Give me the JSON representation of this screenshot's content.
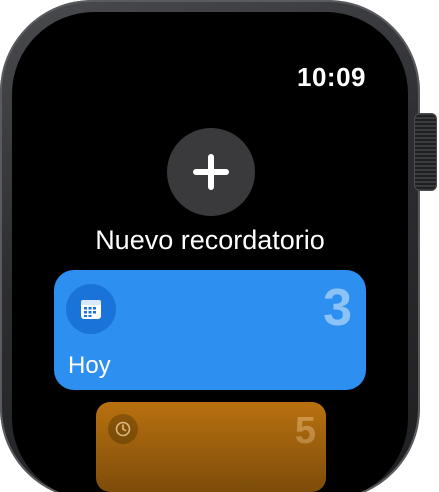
{
  "status": {
    "time": "10:09"
  },
  "actions": {
    "new_reminder_label": "Nuevo recordatorio",
    "new_reminder_icon": "plus-icon"
  },
  "lists": [
    {
      "label": "Hoy",
      "count": "3",
      "icon": "calendar-icon",
      "color": "#2d8ff0"
    },
    {
      "label": "",
      "count": "5",
      "icon": "clock-icon",
      "color": "#b7700f"
    }
  ],
  "colors": {
    "screen_background": "#000000",
    "button_background": "#3a3a3c"
  }
}
